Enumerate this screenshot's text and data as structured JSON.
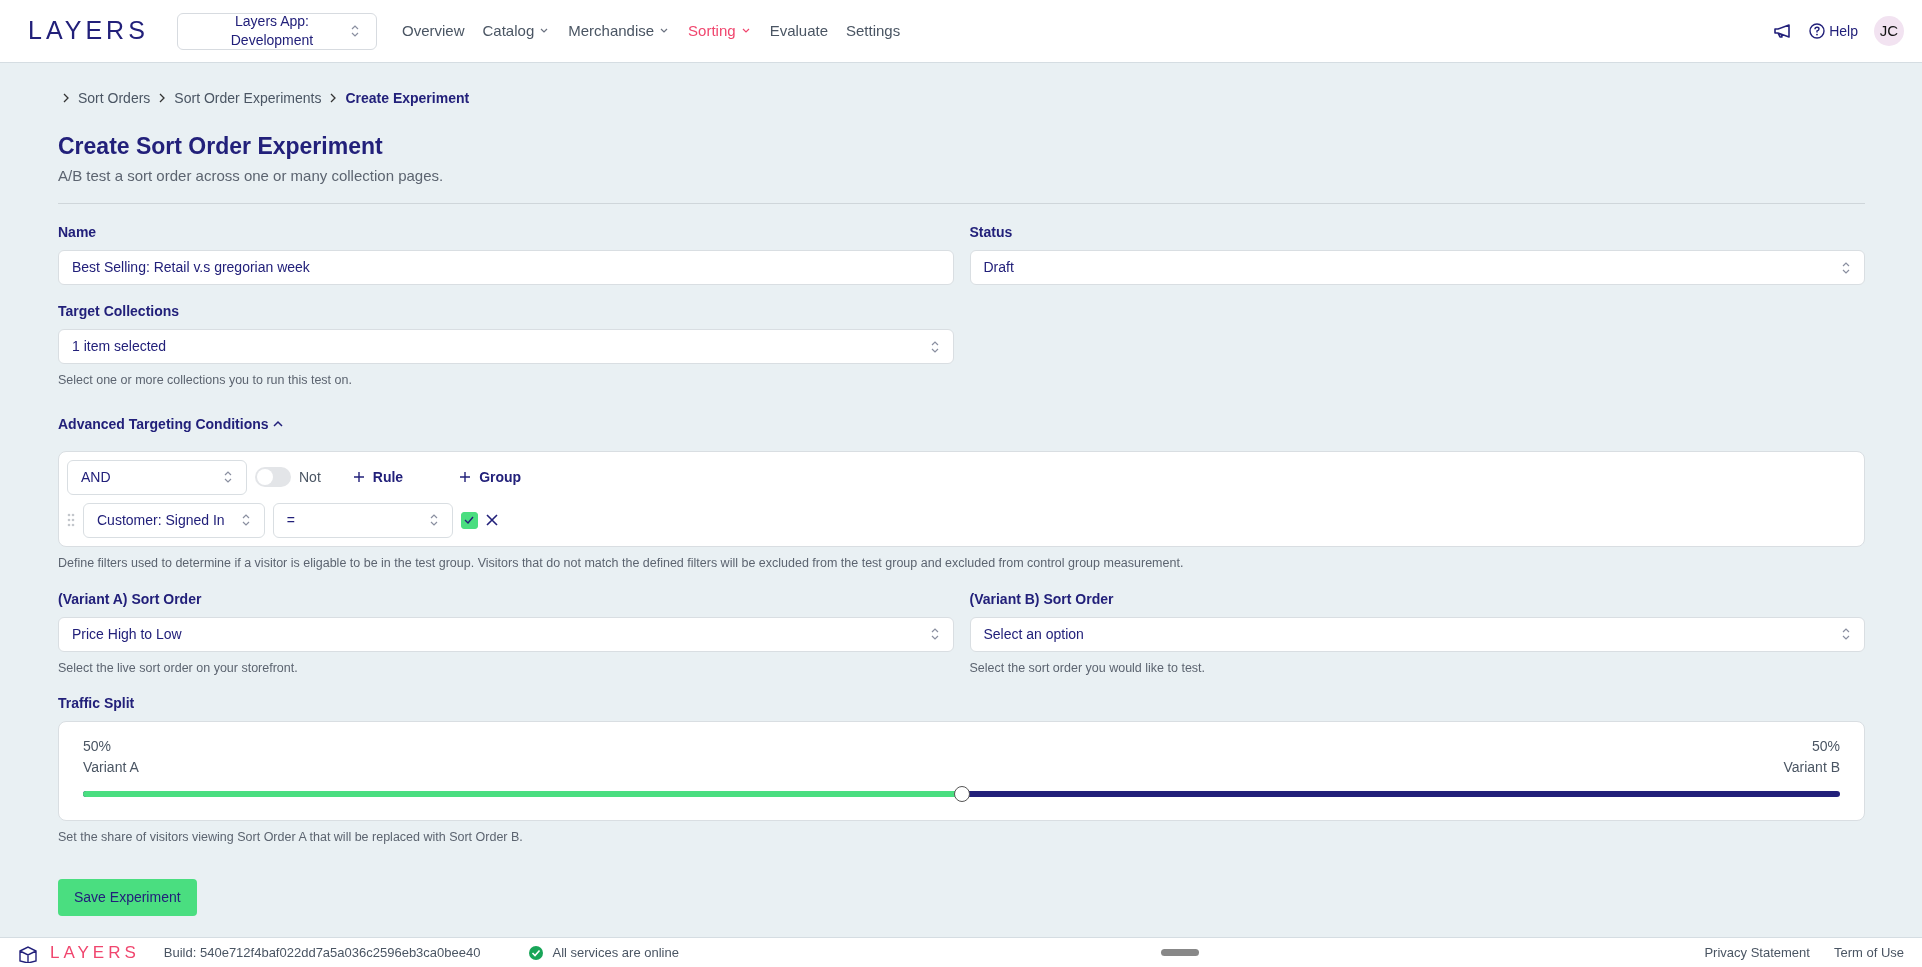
{
  "nav": {
    "logo": "LAYERS",
    "app_select": "Layers App: Development",
    "help": "Help",
    "avatar": "JC",
    "items": [
      {
        "label": "Overview",
        "dropdown": false,
        "selected": false
      },
      {
        "label": "Catalog",
        "dropdown": true,
        "selected": false
      },
      {
        "label": "Merchandise",
        "dropdown": true,
        "selected": false
      },
      {
        "label": "Sorting",
        "dropdown": true,
        "selected": true
      },
      {
        "label": "Evaluate",
        "dropdown": false,
        "selected": false
      },
      {
        "label": "Settings",
        "dropdown": false,
        "selected": false
      }
    ]
  },
  "breadcrumb": [
    "Sort Orders",
    "Sort Order Experiments",
    "Create Experiment"
  ],
  "page": {
    "title": "Create Sort Order Experiment",
    "subtitle": "A/B test a sort order across one or many collection pages."
  },
  "form": {
    "name": {
      "label": "Name",
      "value": "Best Selling: Retail v.s gregorian week"
    },
    "status": {
      "label": "Status",
      "value": "Draft"
    },
    "target": {
      "label": "Target Collections",
      "value": "1 item selected",
      "help": "Select one or more collections you to run this test on."
    },
    "advanced": {
      "label": "Advanced Targeting Conditions",
      "expanded": true
    },
    "conditions": {
      "operator": "AND",
      "not": false,
      "not_label": "Not",
      "add_rule": "Rule",
      "add_group": "Group",
      "rules": [
        {
          "field": "Customer: Signed In",
          "op": "=",
          "checked": true
        }
      ],
      "help": "Define filters used to determine if a visitor is eligable to be in the test group. Visitors that do not match the defined filters will be excluded from the test group and excluded from control group measurement."
    },
    "variant_a": {
      "label": "(Variant A) Sort Order",
      "value": "Price High to Low",
      "help": "Select the live sort order on your storefront."
    },
    "variant_b": {
      "label": "(Variant B) Sort Order",
      "value": "Select an option",
      "help": "Select the sort order you would like to test."
    },
    "traffic": {
      "label": "Traffic Split",
      "left_pct": "50%",
      "left_label": "Variant A",
      "right_pct": "50%",
      "right_label": "Variant B",
      "level": 0.5,
      "help": "Set the share of visitors viewing Sort Order A that will be replaced with Sort Order B."
    },
    "save": "Save Experiment"
  },
  "footer": {
    "logo": "LAYERS",
    "build": "Build: 540e712f4baf022dd7a5a036c2596eb3ca0bee40",
    "status": "All services are online",
    "links": [
      "Privacy Statement",
      "Term of Use"
    ]
  }
}
